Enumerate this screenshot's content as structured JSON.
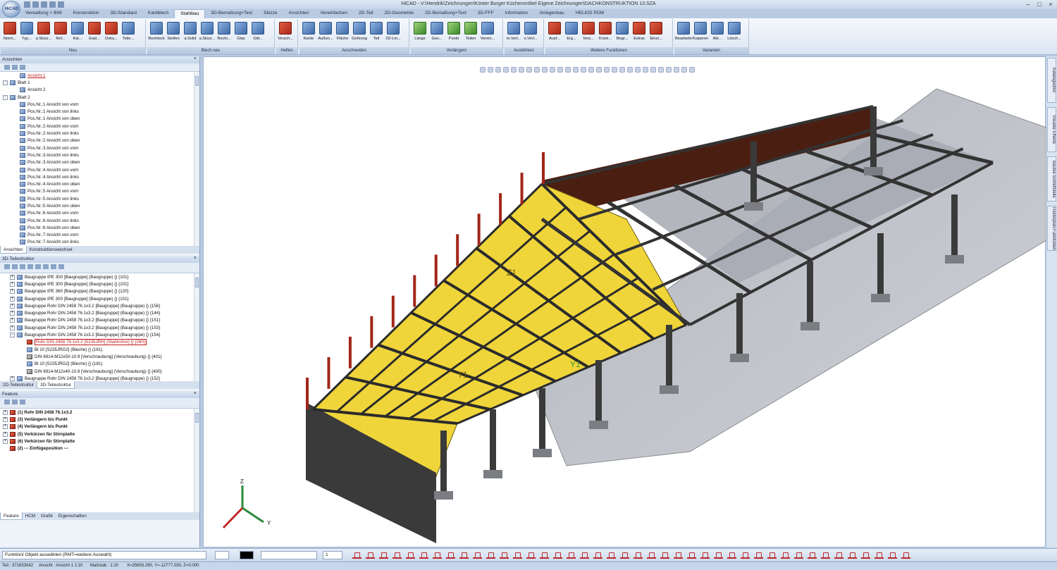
{
  "window": {
    "title": "HiCAD - V:\\Hendrik\\Zeichnungen\\Köster Burger Küchenmöbel Eigene Zeichnungen\\DACHKONSTRUKTION 13.SZA",
    "logo_text": "HiCAD"
  },
  "tabs": [
    "Verwaltung + BIM",
    "Konstruktion",
    "3D-Standard",
    "Kantblech",
    "Stahlbau",
    "3D-Bemaßung+Text",
    "Skizze",
    "Ansichten",
    "Vereinfachen",
    "2D-Teil",
    "2D-Geometrie",
    "2D-Bemaßung+Text",
    "3D-FFF",
    "Information",
    "Anlagenbau",
    "HELiOS PDM"
  ],
  "active_tab": "Stahlbau",
  "ribbon": [
    {
      "label": "Neu",
      "buttons": [
        "Norm...",
        "Typ...",
        "a.Skizz...",
        "Ref...",
        "Kat...",
        "Expl...",
        "Doku...",
        "Teile..."
      ]
    },
    {
      "label": "Blech neu",
      "buttons": [
        "Rechteck",
        "Steifen",
        "a.Solid",
        "a.Skizz...",
        "Recht...",
        "Glas",
        "Gitt..."
      ]
    },
    {
      "label": "Helfen",
      "buttons": [
        "Versch..."
      ]
    },
    {
      "label": "Anschneiden",
      "buttons": [
        "Kante",
        "Außen...",
        "Fläche",
        "Gehrung",
        "Teil",
        "2D-Lin..."
      ]
    },
    {
      "label": "Verlängern",
      "buttons": [
        "Länge",
        "Ges...",
        "Punkt",
        "Teilen",
        "Verein..."
      ]
    },
    {
      "label": "Ausklinken",
      "buttons": [
        "m.Verl...",
        "o.Verl..."
      ]
    },
    {
      "label": "Weitere Funktionen",
      "buttons": [
        "Ausf...",
        "Erg...",
        "Verz...",
        "Krüm...",
        "Begr...",
        "Extras",
        "Einst..."
      ]
    },
    {
      "label": "Varianten",
      "buttons": [
        "Bearbeiten",
        "Kopieren",
        "Akt...",
        "Lösch..."
      ]
    }
  ],
  "views_panel": {
    "title": "Ansichten",
    "items": [
      {
        "text": "Ansicht 1",
        "level": 1,
        "selected": true,
        "exp": ""
      },
      {
        "text": "Blatt 1",
        "level": 0,
        "exp": "-"
      },
      {
        "text": "Ansicht 2",
        "level": 1,
        "exp": ""
      },
      {
        "text": "Blatt 2",
        "level": 0,
        "exp": "-"
      },
      {
        "text": "Pos.Nr.:1 Ansicht von vorn",
        "level": 1,
        "exp": ""
      },
      {
        "text": "Pos.Nr.:1 Ansicht von links",
        "level": 1,
        "exp": ""
      },
      {
        "text": "Pos.Nr.:1 Ansicht von oben",
        "level": 1,
        "exp": ""
      },
      {
        "text": "Pos.Nr.:2 Ansicht von vorn",
        "level": 1,
        "exp": ""
      },
      {
        "text": "Pos.Nr.:2 Ansicht von links",
        "level": 1,
        "exp": ""
      },
      {
        "text": "Pos.Nr.:2 Ansicht von oben",
        "level": 1,
        "exp": ""
      },
      {
        "text": "Pos.Nr.:3 Ansicht von vorn",
        "level": 1,
        "exp": ""
      },
      {
        "text": "Pos.Nr.:3 Ansicht von links",
        "level": 1,
        "exp": ""
      },
      {
        "text": "Pos.Nr.:3 Ansicht von oben",
        "level": 1,
        "exp": ""
      },
      {
        "text": "Pos.Nr.:4 Ansicht von vorn",
        "level": 1,
        "exp": ""
      },
      {
        "text": "Pos.Nr.:4 Ansicht von links",
        "level": 1,
        "exp": ""
      },
      {
        "text": "Pos.Nr.:4 Ansicht von oben",
        "level": 1,
        "exp": ""
      },
      {
        "text": "Pos.Nr.:5 Ansicht von vorn",
        "level": 1,
        "exp": ""
      },
      {
        "text": "Pos.Nr.:5 Ansicht von links",
        "level": 1,
        "exp": ""
      },
      {
        "text": "Pos.Nr.:5 Ansicht von oben",
        "level": 1,
        "exp": ""
      },
      {
        "text": "Pos.Nr.:6 Ansicht von vorn",
        "level": 1,
        "exp": ""
      },
      {
        "text": "Pos.Nr.:6 Ansicht von links",
        "level": 1,
        "exp": ""
      },
      {
        "text": "Pos.Nr.:6 Ansicht von oben",
        "level": 1,
        "exp": ""
      },
      {
        "text": "Pos.Nr.:7 Ansicht von vorn",
        "level": 1,
        "exp": ""
      },
      {
        "text": "Pos.Nr.:7 Ansicht von links",
        "level": 1,
        "exp": ""
      }
    ],
    "tabs": [
      "Ansichten",
      "Konstruktionswechsel"
    ]
  },
  "structure_panel": {
    "title": "3D-Teilestruktur",
    "items": [
      {
        "text": "Baugruppe IPE 300 [Baugruppe] (Baugruppe) {} {101}",
        "level": 0,
        "exp": "+"
      },
      {
        "text": "Baugruppe IPE 300 [Baugruppe] (Baugruppe) {} {101}",
        "level": 0,
        "exp": "+"
      },
      {
        "text": "Baugruppe IPE 360 [Baugruppe] (Baugruppe) {} {120}",
        "level": 0,
        "exp": "+"
      },
      {
        "text": "Baugruppe IPE 300 [Baugruppe] (Baugruppe) {} {101}",
        "level": 0,
        "exp": "+"
      },
      {
        "text": "Baugruppe Rohr DIN 2458 76.1x3.2 [Baugruppe] (Baugruppe) {} {156}",
        "level": 0,
        "exp": "+"
      },
      {
        "text": "Baugruppe Rohr DIN 2458 76.1x3.2 [Baugruppe] (Baugruppe) {} {144}",
        "level": 0,
        "exp": "+"
      },
      {
        "text": "Baugruppe Rohr DIN 2458 76.1x3.2 [Baugruppe] (Baugruppe) {} {151}",
        "level": 0,
        "exp": "+"
      },
      {
        "text": "Baugruppe Rohr DIN 2458 76.1x3.2 [Baugruppe] (Baugruppe) {} {153}",
        "level": 0,
        "exp": "+"
      },
      {
        "text": "Baugruppe Rohr DIN 2458 76.1x3.2 [Baugruppe] (Baugruppe) {} {154}",
        "level": 0,
        "exp": "-"
      },
      {
        "text": "Rohr DIN 2458 76.1x3.2 [S235JRH] (Stahlrohre) {} {280}",
        "level": 1,
        "exp": "",
        "hl": true,
        "icon": "r"
      },
      {
        "text": "Bl 10 [S235JRG2] (Bleche) {} {181}",
        "level": 1,
        "exp": ""
      },
      {
        "text": "DIN 6914-M12x50-10.9 [Verschraubung] (Verschraubung) {} {401}",
        "level": 1,
        "exp": "",
        "icon": "bolt"
      },
      {
        "text": "Bl 10 [S235JRG2] (Bleche) {} {181}",
        "level": 1,
        "exp": ""
      },
      {
        "text": "DIN 6914-M12x40-10.9 [Verschraubung] (Verschraubung) {} {400}",
        "level": 1,
        "exp": "",
        "icon": "bolt"
      },
      {
        "text": "Baugruppe Rohr DIN 2458 76.1x3.2 [Baugruppe] (Baugruppe) {} {152}",
        "level": 0,
        "exp": "+"
      }
    ],
    "tabs": [
      "2D-Teilestruktur",
      "3D-Teilestruktur"
    ]
  },
  "feature_panel": {
    "title": "Feature",
    "items": [
      {
        "text": "(1) Rohr DIN 2458 76.1x3.2",
        "exp": "+"
      },
      {
        "text": "(3) Verlängern bis Punkt",
        "exp": "+"
      },
      {
        "text": "(4) Verlängern bis Punkt",
        "exp": "+"
      },
      {
        "text": "(5) Verkürzen für Stirnplatte",
        "exp": "+"
      },
      {
        "text": "(6) Verkürzen für Stirnplatte",
        "exp": "+"
      },
      {
        "text": "(2) --- Einfügeposition ---",
        "exp": ""
      }
    ],
    "tabs": [
      "Feature",
      "HCM",
      "Grafik",
      "Eigenschaften"
    ]
  },
  "right_tabs": [
    "Katalogeditor",
    "Visuelle Effekte",
    "Bauteil-Schnittstelle",
    "Rasterplan-Funktionen"
  ],
  "viewport": {
    "labels": [
      "Z1",
      "Y1",
      "Y1"
    ],
    "axes": {
      "x": "X",
      "y": "Y",
      "z": "Z"
    }
  },
  "colors": {
    "deck": "#f0d53a",
    "steel": "#3a3a3a",
    "wall": "#4a1f12",
    "accent": "#c0282a"
  },
  "command": {
    "prompt": "Funktion/ Objekt auswählen (RMT=weitere Auswahl)",
    "layer": "1"
  },
  "status": {
    "teil": "Teil : 371633042",
    "ansicht": "Ansicht : Ansicht 1 1:10",
    "massstab": "Maßstab : 1:10",
    "coords": "X=25693.290, Y=-12777.030, Z=0.000"
  }
}
